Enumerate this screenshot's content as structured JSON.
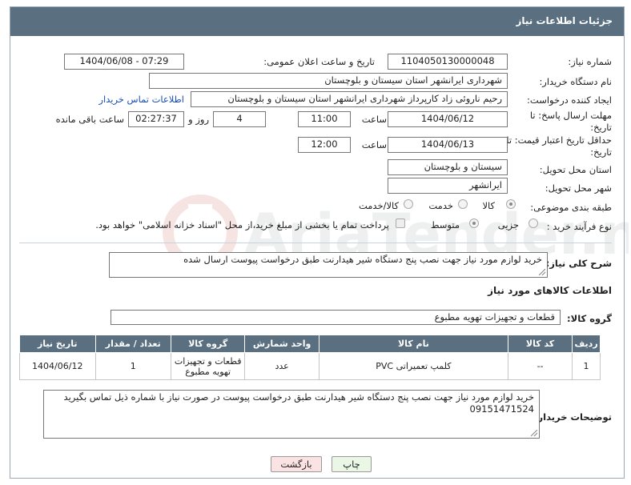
{
  "header": {
    "title": "جزئیات اطلاعات نیاز"
  },
  "need_number": {
    "label": "شماره نیاز:",
    "value": "1104050130000048"
  },
  "announce": {
    "label": "تاریخ و ساعت اعلان عمومی:",
    "value": "1404/06/08 - 07:29"
  },
  "buyer_org": {
    "label": "نام دستگاه خریدار:",
    "value": "شهرداری ایرانشهر استان سیستان و بلوچستان"
  },
  "requester": {
    "label": "ایجاد کننده درخواست:",
    "value": "رحیم ناروئی زاد کارپرداز شهرداری ایرانشهر استان سیستان و بلوچستان",
    "contact_link": "اطلاعات تماس خریدار"
  },
  "deadline": {
    "label": "مهلت ارسال پاسخ: تا تاریخ:",
    "date": "1404/06/12",
    "time_label": "ساعت",
    "time": "11:00",
    "days": "4",
    "days_label": "روز و",
    "remaining": "02:27:37",
    "remaining_label": "ساعت باقی مانده"
  },
  "price_validity": {
    "label": "حداقل تاریخ اعتبار قیمت: تا تاریخ:",
    "date": "1404/06/13",
    "time_label": "ساعت",
    "time": "12:00"
  },
  "delivery_province": {
    "label": "استان محل تحویل:",
    "value": "سیستان و بلوچستان"
  },
  "delivery_city": {
    "label": "شهر محل تحویل:",
    "value": "ایرانشهر"
  },
  "category": {
    "label": "طبقه بندی موضوعی:",
    "options": [
      "کالا",
      "خدمت",
      "کالا/خدمت"
    ],
    "selected": 0
  },
  "process": {
    "label": "نوع فرآیند خرید :",
    "options": [
      "جزیی",
      "متوسط"
    ],
    "selected": 1,
    "note": "پرداخت تمام یا بخشی از مبلغ خرید،از محل \"اسناد خزانه اسلامی\" خواهد بود."
  },
  "description": {
    "label": "شرح کلی نیاز:",
    "value": "خرید لوازم مورد نیاز جهت نصب پنج دستگاه شیر هیدارنت طبق درخواست پیوست ارسال شده"
  },
  "goods_section": {
    "title": "اطلاعات کالاهای مورد نیاز"
  },
  "goods_group": {
    "label": "گروه کالا:",
    "value": "قطعات و تجهیزات تهویه مطبوع"
  },
  "table": {
    "headers": [
      "ردیف",
      "کد کالا",
      "نام کالا",
      "واحد شمارش",
      "گروه کالا",
      "تعداد / مقدار",
      "تاریخ نیاز"
    ],
    "rows": [
      [
        "1",
        "--",
        "کلمپ تعمیراتی PVC",
        "عدد",
        "قطعات و تجهیزات تهویه مطبوع",
        "1",
        "1404/06/12"
      ]
    ]
  },
  "buyer_notes": {
    "label": "توضیحات خریدار:",
    "value": "خرید لوازم مورد نیاز جهت نصب پنج دستگاه شیر هیدارنت طبق درخواست پیوست در صورت نیاز با شماره ذیل تماس بگیرید 09151471524"
  },
  "buttons": {
    "print": "چاپ",
    "back": "بازگشت"
  },
  "watermark_text": "AriaTender.net",
  "colors": {
    "header": "#5a6f80",
    "link": "#1a4fb6",
    "print_btn": "#e9f7e4",
    "back_btn": "#fbe3e3"
  }
}
